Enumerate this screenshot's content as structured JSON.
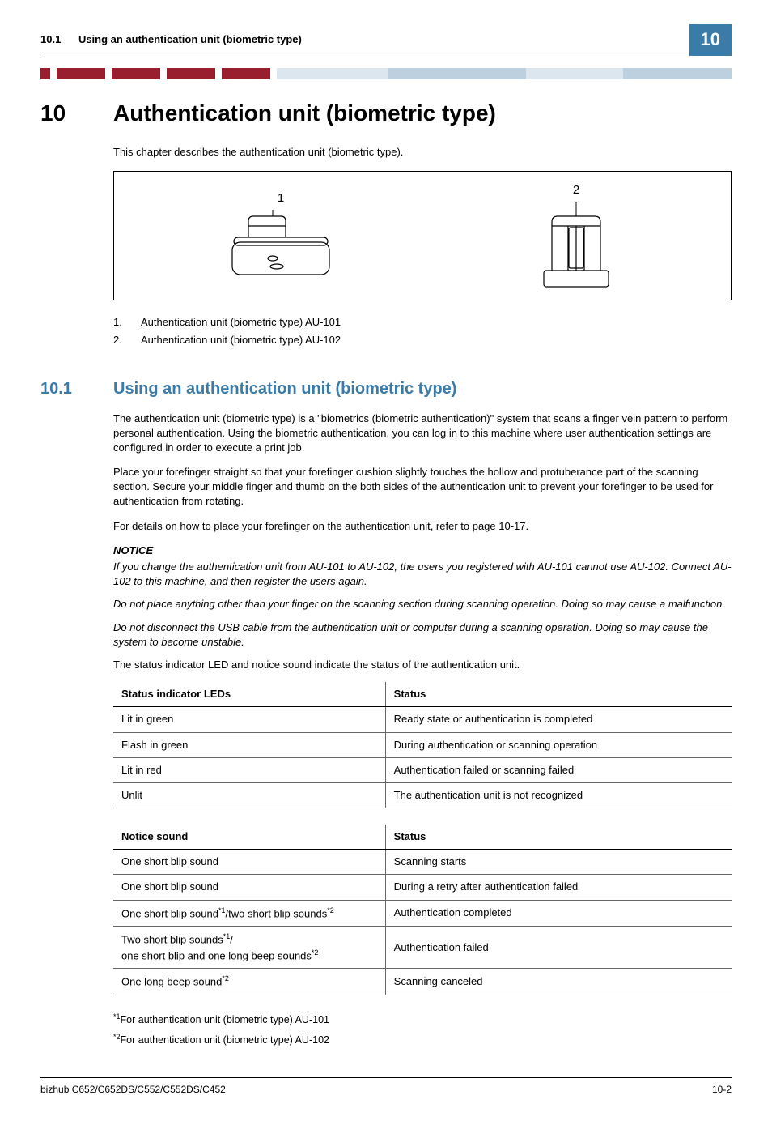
{
  "header": {
    "section_number": "10.1",
    "section_title": "Using an authentication unit (biometric type)",
    "tab": "10"
  },
  "chapter": {
    "number": "10",
    "title": "Authentication unit (biometric type)",
    "intro": "This chapter describes the authentication unit (biometric type)."
  },
  "figure": {
    "callout1": "1",
    "callout2": "2",
    "legend": [
      {
        "n": "1.",
        "t": "Authentication unit (biometric type) AU-101"
      },
      {
        "n": "2.",
        "t": "Authentication unit (biometric type) AU-102"
      }
    ]
  },
  "section": {
    "number": "10.1",
    "title": "Using an authentication unit (biometric type)",
    "p1": "The authentication unit (biometric type) is a \"biometrics (biometric authentication)\" system that scans a finger vein pattern to perform personal authentication. Using the biometric authentication, you can log in to this machine where user authentication settings are configured in order to execute a print job.",
    "p2": "Place your forefinger straight so that your forefinger cushion slightly touches the hollow and protuberance part of the scanning section. Secure your middle finger and thumb on the both sides of the authentication unit to prevent your forefinger to be used for authentication from rotating.",
    "p3": "For details on how to place your forefinger on the authentication unit, refer to page 10-17.",
    "notice_heading": "NOTICE",
    "notice1": "If you change the authentication unit from AU-101 to AU-102, the users you registered with AU-101 cannot use AU-102. Connect AU-102 to this machine, and then register the users again.",
    "notice2": "Do not place anything other than your finger on the scanning section during scanning operation. Doing so may cause a malfunction.",
    "notice3": "Do not disconnect the USB cable from the authentication unit or computer during a scanning operation. Doing so may cause the system to become unstable.",
    "p4": "The status indicator LED and notice sound indicate the status of the authentication unit."
  },
  "table1": {
    "h1": "Status indicator LEDs",
    "h2": "Status",
    "rows": [
      {
        "c1": "Lit in green",
        "c2": "Ready state or authentication is completed"
      },
      {
        "c1": "Flash in green",
        "c2": "During authentication or scanning operation"
      },
      {
        "c1": "Lit in red",
        "c2": "Authentication failed or scanning failed"
      },
      {
        "c1": "Unlit",
        "c2": "The authentication unit is not recognized"
      }
    ]
  },
  "table2": {
    "h1": "Notice sound",
    "h2": "Status",
    "rows": [
      {
        "c1_parts": [
          "One short blip sound"
        ],
        "c2": "Scanning starts"
      },
      {
        "c1_parts": [
          "One short blip sound"
        ],
        "c2": "During a retry after authentication failed"
      },
      {
        "c1_parts": [
          "One short blip sound",
          {
            "sup": "*1"
          },
          "/two short blip sounds",
          {
            "sup": "*2"
          }
        ],
        "c2": "Authentication completed"
      },
      {
        "c1_parts": [
          "Two short blip sounds",
          {
            "sup": "*1"
          },
          "/",
          {
            "br": true
          },
          "one short blip and one long beep sounds",
          {
            "sup": "*2"
          }
        ],
        "c2": "Authentication failed"
      },
      {
        "c1_parts": [
          "One long beep sound",
          {
            "sup": "*2"
          }
        ],
        "c2": "Scanning canceled"
      }
    ]
  },
  "footnotes": {
    "f1_sup": "*1",
    "f1_text": "For authentication unit (biometric type) AU-101",
    "f2_sup": "*2",
    "f2_text": "For authentication unit (biometric type) AU-102"
  },
  "footer": {
    "left": "bizhub C652/C652DS/C552/C552DS/C452",
    "right": "10-2"
  }
}
